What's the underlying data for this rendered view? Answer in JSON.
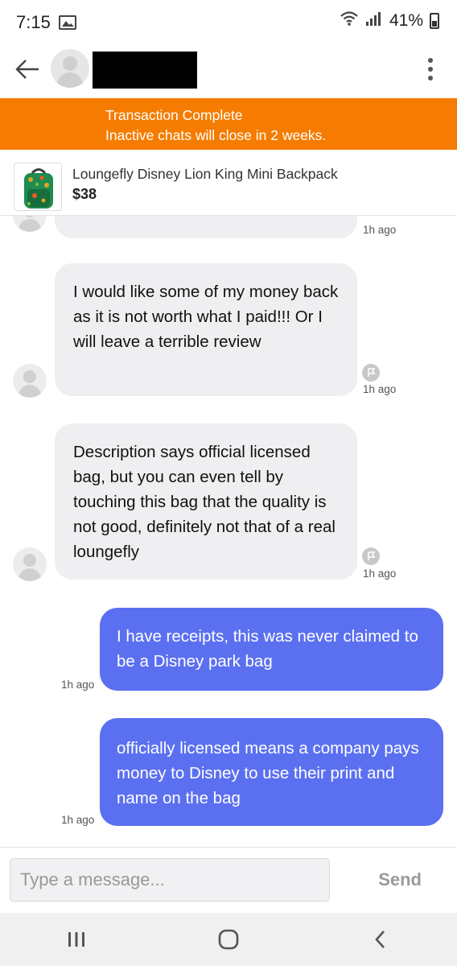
{
  "status_bar": {
    "time": "7:15",
    "battery": "41%"
  },
  "header": {
    "back_icon": "arrow-left-icon",
    "menu_icon": "more-vertical-icon"
  },
  "banner": {
    "line1": "Transaction Complete",
    "line2": "Inactive chats will close in 2 weeks.",
    "color": "#f57c00"
  },
  "product": {
    "title": "Loungefly Disney Lion King Mini Backpack",
    "price": "$38"
  },
  "messages": [
    {
      "direction": "incoming",
      "text": "",
      "time": "1h ago"
    },
    {
      "direction": "incoming",
      "text": "I would like some of my money back as it is not worth what I paid!!! Or I will leave a terrible review",
      "time": "1h ago"
    },
    {
      "direction": "incoming",
      "text": "Description says official licensed bag, but you can even tell by touching this bag that the quality is not good, definitely not that of a real loungefly",
      "time": "1h ago"
    },
    {
      "direction": "outgoing",
      "text": "I have receipts, this was never claimed to be a Disney park bag",
      "time": "1h ago"
    },
    {
      "direction": "outgoing",
      "text": "officially licensed means a company pays money to Disney to use their print and name on the bag",
      "time": "1h ago"
    }
  ],
  "composer": {
    "placeholder": "Type a message...",
    "send_label": "Send"
  },
  "colors": {
    "outgoing_bubble": "#5b70f0",
    "incoming_bubble": "#efeff2"
  }
}
